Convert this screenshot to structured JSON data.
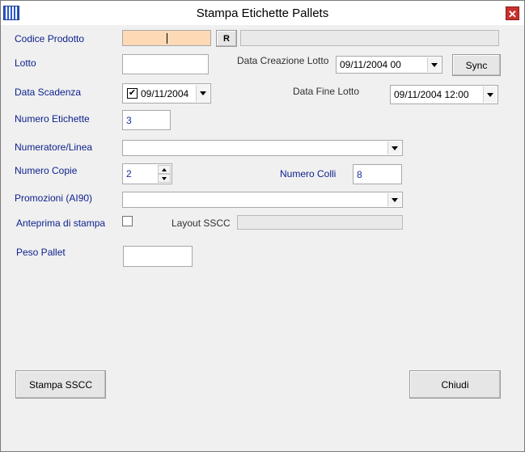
{
  "window": {
    "title": "Stampa Etichette Pallets",
    "close_label": "✕"
  },
  "form": {
    "codice_prodotto": {
      "label": "Codice Prodotto",
      "value": "",
      "lookup_button": "R",
      "description": ""
    },
    "lotto": {
      "label": "Lotto",
      "value": ""
    },
    "data_creazione_lotto": {
      "label": "Data Creazione Lotto",
      "value": "09/11/2004 00"
    },
    "sync_button": "Sync",
    "data_scadenza": {
      "label": "Data Scadenza",
      "checked": true,
      "value": "09/11/2004"
    },
    "data_fine_lotto": {
      "label": "Data Fine Lotto",
      "value": "09/11/2004 12:00"
    },
    "numero_etichette": {
      "label": "Numero Etichette",
      "value": "3"
    },
    "numeratore_linea": {
      "label": "Numeratore/Linea",
      "value": ""
    },
    "numero_copie": {
      "label": "Numero Copie",
      "value": "2"
    },
    "numero_colli": {
      "label": "Numero Colli",
      "value": "8"
    },
    "promozioni": {
      "label": "Promozioni (AI90)",
      "value": ""
    },
    "anteprima_di_stampa": {
      "label": "Anteprima di stampa",
      "checked": false
    },
    "layout_sscc": {
      "label": "Layout SSCC",
      "value": ""
    },
    "peso_pallet": {
      "label": "Peso Pallet",
      "value": ""
    }
  },
  "buttons": {
    "stampa_sscc": "Stampa SSCC",
    "chiudi": "Chiudi"
  }
}
